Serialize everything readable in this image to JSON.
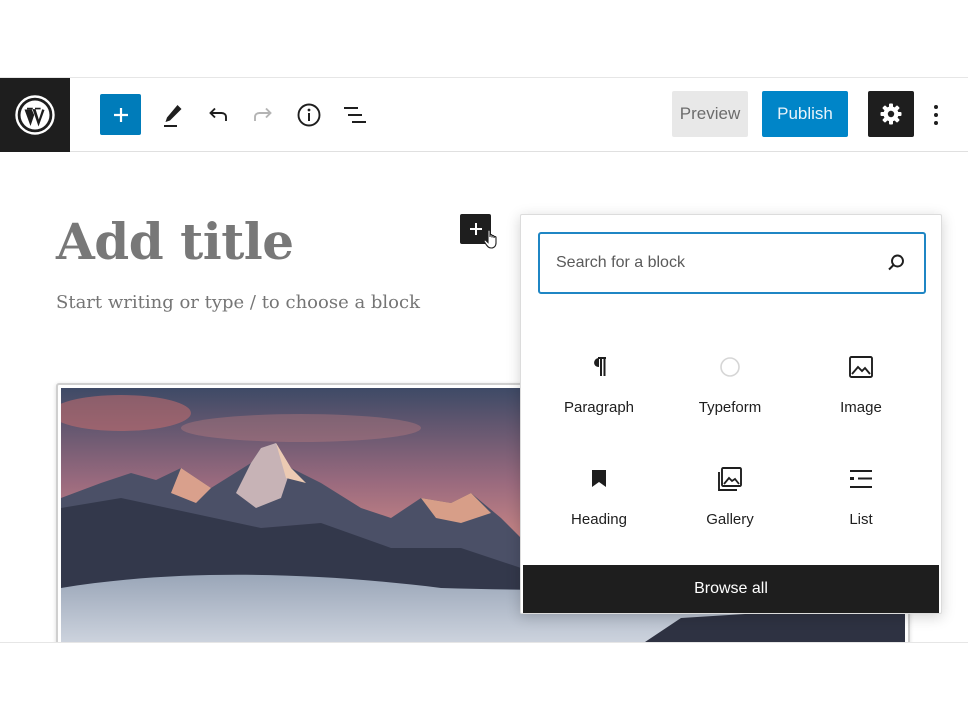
{
  "toolbar": {
    "logo": "wordpress-logo",
    "add_block_icon": "plus-icon",
    "tools_icon": "pencil-icon",
    "undo_icon": "undo-icon",
    "redo_icon": "redo-icon",
    "info_icon": "info-icon",
    "outline_icon": "list-view-icon",
    "preview_label": "Preview",
    "publish_label": "Publish",
    "settings_icon": "gear-icon",
    "more_icon": "more-vertical-icon"
  },
  "editor": {
    "title_placeholder": "Add title",
    "body_placeholder": "Start writing or type / to choose a block"
  },
  "inserter": {
    "search_placeholder": "Search for a block",
    "search_value": "",
    "blocks": [
      {
        "label": "Paragraph",
        "icon": "paragraph-icon"
      },
      {
        "label": "Typeform",
        "icon": "circle-icon"
      },
      {
        "label": "Image",
        "icon": "image-icon"
      },
      {
        "label": "Heading",
        "icon": "bookmark-icon"
      },
      {
        "label": "Gallery",
        "icon": "gallery-icon"
      },
      {
        "label": "List",
        "icon": "list-icon"
      }
    ],
    "browse_all_label": "Browse all"
  },
  "colors": {
    "accent": "#007cba",
    "publish": "#0085c8",
    "dark": "#1e1e1e"
  }
}
